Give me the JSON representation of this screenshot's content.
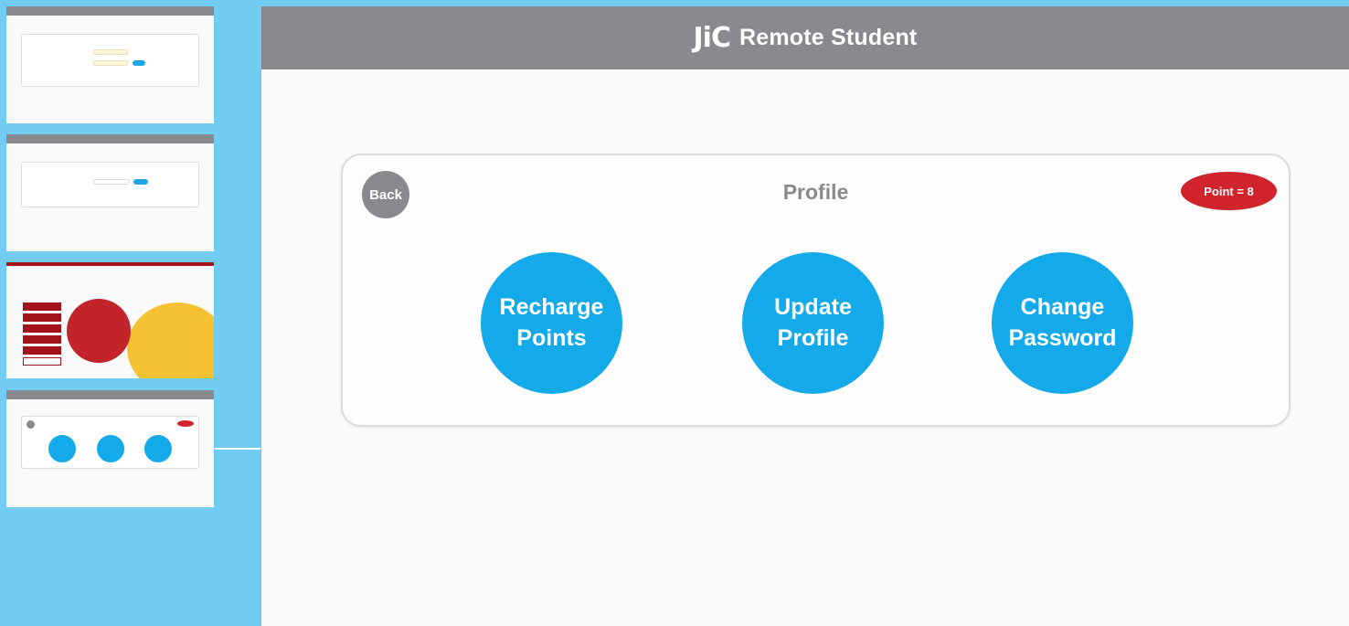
{
  "header": {
    "logo_text": "JiC",
    "title": "Remote Student"
  },
  "card": {
    "title": "Profile",
    "back_label": "Back",
    "points_label": "Point = 8"
  },
  "actions": [
    {
      "line1": "Recharge",
      "line2": "Points"
    },
    {
      "line1": "Update",
      "line2": "Profile"
    },
    {
      "line1": "Change",
      "line2": "Password"
    }
  ],
  "colors": {
    "background": "#72cbf1",
    "header": "#8a8a8e",
    "action_circle": "#14a9e8",
    "points_badge": "#d0232b"
  },
  "icons": [
    "jic-logo"
  ]
}
